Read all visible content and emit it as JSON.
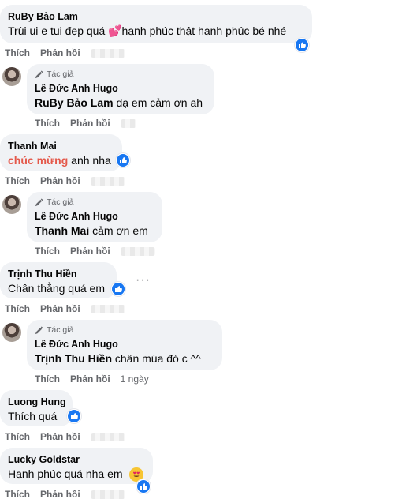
{
  "actions": {
    "like": "Thích",
    "reply": "Phản hồi"
  },
  "author_badge": "Tác giả",
  "comments": [
    {
      "name": "RuBy Bảo Lam",
      "text": "Trùi ui e tui đẹp quá 💕hạnh phúc thật hạnh phúc bé nhé",
      "reaction": "like-icon"
    },
    {
      "name": "Lê Đức Anh Hugo",
      "mention": "RuBy Bảo Lam",
      "text": "dạ em cảm ơn ah"
    },
    {
      "name": "Thanh Mai",
      "highlight": "chúc mừng",
      "text": "anh nha",
      "reaction": "like-icon"
    },
    {
      "name": "Lê Đức Anh Hugo",
      "mention": "Thanh Mai",
      "text": "cảm ơn em"
    },
    {
      "name": "Trịnh Thu Hiền",
      "text": "Chân thẳng quá em",
      "reaction": "like-icon",
      "more": "···"
    },
    {
      "name": "Lê Đức Anh Hugo",
      "mention": "Trịnh Thu Hiền",
      "text": "chân múa đó c ^^",
      "time": "1 ngày"
    },
    {
      "name": "Luong Hung",
      "text": "Thích quá",
      "reaction": "like-icon"
    },
    {
      "name": "Lucky Goldstar",
      "text": "Hạnh phúc quá nha em",
      "reaction": "heart-eyes-and-like-icon"
    }
  ],
  "colors": {
    "bubble": "#f0f2f5",
    "like_blue": "#1877f2",
    "highlight": "#e4584a",
    "muted": "#65676b"
  }
}
